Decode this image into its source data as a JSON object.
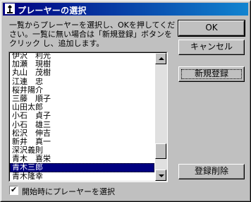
{
  "window": {
    "title": "プレーヤーの選択"
  },
  "instructions": "一覧からプレーヤーを選択し、OKを押してください。一覧に無い場合は「新規登録」ボタンをクリック し、追加します。",
  "players": [
    "伊沢　利光",
    "加瀬　現樹",
    "丸山　茂樹",
    "江連　忠",
    "桜井陽介",
    "三藤　順子",
    "山田太郎",
    "小石　貞子",
    "小石　雄三",
    "松沢　伸吉",
    "新井　真一",
    "深沢義則",
    "青木　喜栄",
    "青木三郎",
    "青木隆幸"
  ],
  "selected_index": 13,
  "buttons": {
    "ok": "OK",
    "cancel": "キャンセル",
    "new_register": "新規登録",
    "delete_register": "登録削除"
  },
  "startup_option": {
    "label": "開始時にプレーヤーを選択",
    "checked": true
  },
  "colors": {
    "titlebar": "#000080",
    "selection": "#000080",
    "face": "#c0c0c0"
  }
}
